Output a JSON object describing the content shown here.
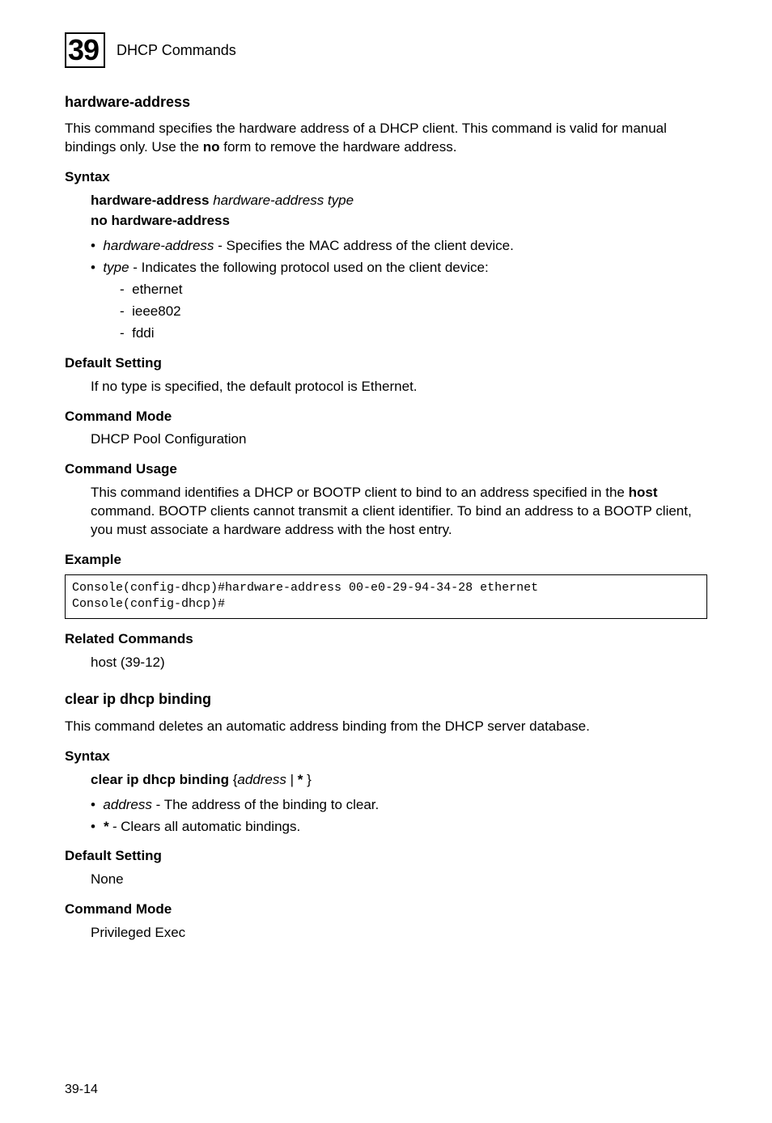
{
  "header": {
    "chapterNumber": "39",
    "chapterTitle": "DHCP Commands"
  },
  "s1": {
    "heading": "hardware-address",
    "intro_p1": "This command specifies the hardware address of a DHCP client. This command is valid for manual bindings only. Use the ",
    "intro_no": "no",
    "intro_p2": " form to remove the hardware address.",
    "syntax_h": "Syntax",
    "syntax_l1_b": "hardware-address",
    "syntax_l1_i": "hardware-address type",
    "syntax_l2_b1": "no",
    "syntax_l2_b2": "hardware-address",
    "b1_i": "hardware-address",
    "b1_t": " - Specifies the MAC address of the client device.",
    "b2_i": "type",
    "b2_t": " - Indicates the following protocol used on the client device:",
    "d1": "ethernet",
    "d2": "ieee802",
    "d3": "fddi",
    "ds_h": "Default Setting",
    "ds_t": "If no type is specified, the default protocol is Ethernet.",
    "cm_h": "Command Mode",
    "cm_t": "DHCP Pool Configuration",
    "cu_h": "Command Usage",
    "cu_t1": "This command identifies a DHCP or BOOTP client to bind to an address specified in the ",
    "cu_tb": "host",
    "cu_t2": " command. BOOTP clients cannot transmit a client identifier. To bind an address to a BOOTP client, you must associate a hardware address with the host entry.",
    "ex_h": "Example",
    "ex_code": "Console(config-dhcp)#hardware-address 00-e0-29-94-34-28 ethernet\nConsole(config-dhcp)#",
    "rc_h": "Related Commands",
    "rc_t": "host (39-12)"
  },
  "s2": {
    "heading": "clear ip dhcp binding",
    "intro": "This command deletes an automatic address binding from the DHCP server database.",
    "syntax_h": "Syntax",
    "syntax_b": "clear ip dhcp binding",
    "syntax_rest_1": "{",
    "syntax_i": "address",
    "syntax_rest_2": " | ",
    "syntax_star": "*",
    "syntax_rest_3": " }",
    "b1_i": "address",
    "b1_t": " - The address of the binding to clear.",
    "b2_bi": "*",
    "b2_t": " Clears all automatic bindings.",
    "ds_h": "Default Setting",
    "ds_t": "None",
    "cm_h": "Command Mode",
    "cm_t": "Privileged Exec"
  },
  "pageNumber": "39-14"
}
